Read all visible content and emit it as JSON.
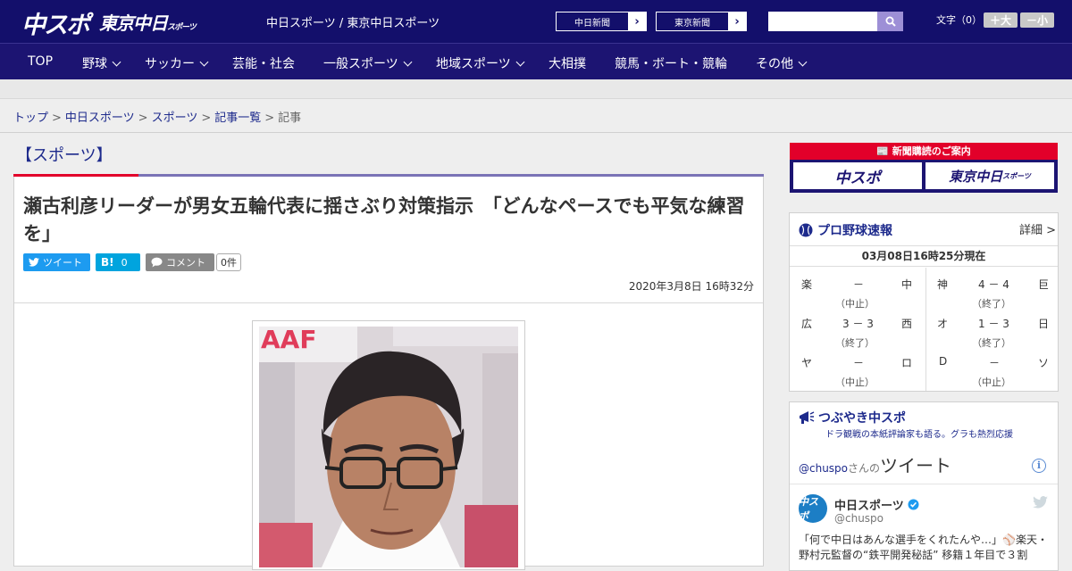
{
  "header": {
    "logo_chuspo": "中スポ",
    "logo_tokyo": "東京中日",
    "logo_tokyo_small": "スポーツ",
    "site_names": "中日スポーツ / 東京中日スポーツ",
    "paper_buttons": [
      {
        "label": "中日新聞"
      },
      {
        "label": "東京新聞"
      }
    ],
    "search_placeholder": "",
    "fontsize_label": "文字（0）",
    "font_plus": "＋大",
    "font_minus": "－小"
  },
  "nav": {
    "items": [
      {
        "label": "TOP",
        "dropdown": false
      },
      {
        "label": "野球",
        "dropdown": true
      },
      {
        "label": "サッカー",
        "dropdown": true
      },
      {
        "label": "芸能・社会",
        "dropdown": false
      },
      {
        "label": "一般スポーツ",
        "dropdown": true
      },
      {
        "label": "地域スポーツ",
        "dropdown": true
      },
      {
        "label": "大相撲",
        "dropdown": false
      },
      {
        "label": "競馬・ボート・競輪",
        "dropdown": false
      },
      {
        "label": "その他",
        "dropdown": true
      }
    ]
  },
  "breadcrumb": {
    "items": [
      "トップ",
      "中日スポーツ",
      "スポーツ",
      "記事一覧"
    ],
    "current": "記事",
    "separator": ">"
  },
  "section_title": "【スポーツ】",
  "article": {
    "headline": "瀬古利彦リーダーが男女五輪代表に揺さぶり対策指示　「どんなペースでも平気な練習を」",
    "tweet_label": "ツイート",
    "hatena_label": "B!",
    "hatena_count": "0",
    "comment_label": "コメント",
    "comment_count": "0件",
    "date": "2020年3月8日 16時32分"
  },
  "sidebar": {
    "subscribe_title": "新聞購読のご案内",
    "subscribe_chuspo": "中スポ",
    "subscribe_tokyo": "東京中日",
    "subscribe_tokyo_small": "スポーツ",
    "baseball_title": "プロ野球速報",
    "detail_link": "詳細 >",
    "timestamp": "03月08日16時25分現在",
    "games": [
      {
        "home": "楽",
        "score": "－",
        "away": "中",
        "status": "（中止）"
      },
      {
        "home": "神",
        "score": "4 － 4",
        "away": "巨",
        "status": "（終了）"
      },
      {
        "home": "広",
        "score": "3 － 3",
        "away": "西",
        "status": "（終了）"
      },
      {
        "home": "オ",
        "score": "1 － 3",
        "away": "日",
        "status": "（終了）"
      },
      {
        "home": "ヤ",
        "score": "－",
        "away": "ロ",
        "status": "（中止）"
      },
      {
        "home": "D",
        "score": "－",
        "away": "ソ",
        "status": "（中止）"
      }
    ],
    "tsubo_title": "つぶやき中スポ",
    "tsubo_sub": "ドラ観戦の本紙評論家も語る。グラも熱烈応援",
    "tw_handle_link": "@chuspo",
    "tw_san": "さんの",
    "tw_word": "ツイート",
    "tweet": {
      "avatar_text": "中スポ",
      "name": "中日スポーツ",
      "handle": "@chuspo",
      "text": "「何で中日はあんな選手をくれたんや…」⚾楽天・野村元監督の“鉄平開発秘話” 移籍１年目で３割"
    }
  }
}
